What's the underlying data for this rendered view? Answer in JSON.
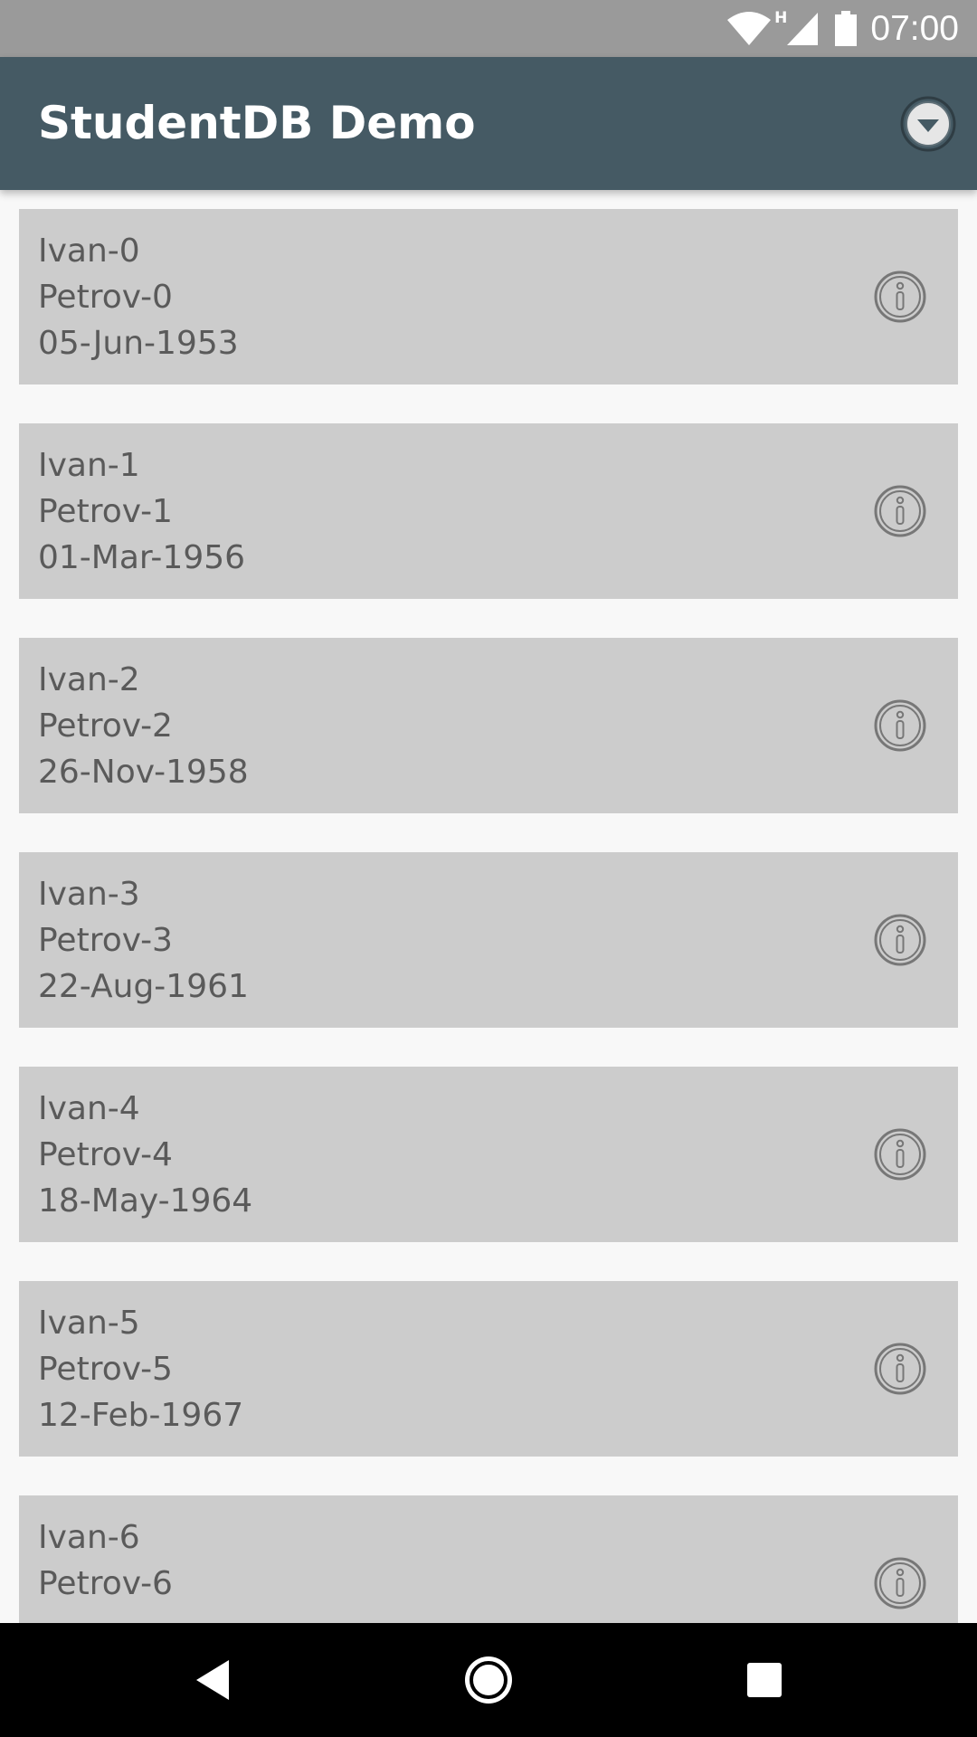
{
  "status_bar": {
    "time": "07:00",
    "network_label": "H"
  },
  "app_bar": {
    "title": "StudentDB Demo",
    "menu_icon": "dropdown-circle-icon"
  },
  "students": [
    {
      "first_name": "Ivan-0",
      "last_name": "Petrov-0",
      "birth_date": "05-Jun-1953"
    },
    {
      "first_name": "Ivan-1",
      "last_name": "Petrov-1",
      "birth_date": "01-Mar-1956"
    },
    {
      "first_name": "Ivan-2",
      "last_name": "Petrov-2",
      "birth_date": "26-Nov-1958"
    },
    {
      "first_name": "Ivan-3",
      "last_name": "Petrov-3",
      "birth_date": "22-Aug-1961"
    },
    {
      "first_name": "Ivan-4",
      "last_name": "Petrov-4",
      "birth_date": "18-May-1964"
    },
    {
      "first_name": "Ivan-5",
      "last_name": "Petrov-5",
      "birth_date": "12-Feb-1967"
    },
    {
      "first_name": "Ivan-6",
      "last_name": "Petrov-6",
      "birth_date": ""
    }
  ],
  "colors": {
    "app_bar": "#455a64",
    "card": "#cccccc",
    "background": "#f8f8f8"
  }
}
